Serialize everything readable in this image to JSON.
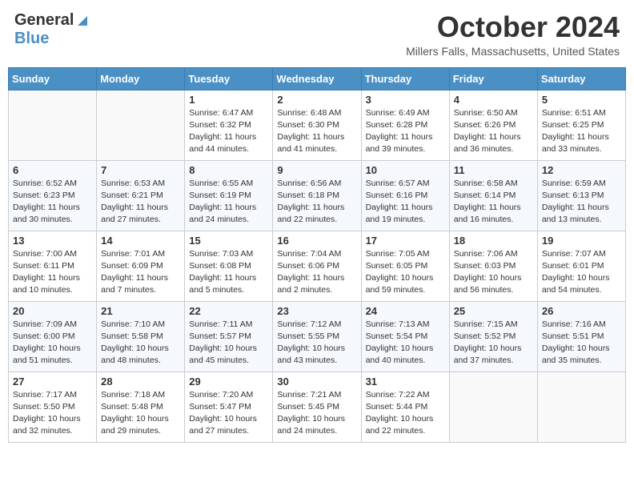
{
  "header": {
    "logo_general": "General",
    "logo_blue": "Blue",
    "month_title": "October 2024",
    "location": "Millers Falls, Massachusetts, United States"
  },
  "days_of_week": [
    "Sunday",
    "Monday",
    "Tuesday",
    "Wednesday",
    "Thursday",
    "Friday",
    "Saturday"
  ],
  "weeks": [
    [
      {
        "day": "",
        "info": ""
      },
      {
        "day": "",
        "info": ""
      },
      {
        "day": "1",
        "info": "Sunrise: 6:47 AM\nSunset: 6:32 PM\nDaylight: 11 hours and 44 minutes."
      },
      {
        "day": "2",
        "info": "Sunrise: 6:48 AM\nSunset: 6:30 PM\nDaylight: 11 hours and 41 minutes."
      },
      {
        "day": "3",
        "info": "Sunrise: 6:49 AM\nSunset: 6:28 PM\nDaylight: 11 hours and 39 minutes."
      },
      {
        "day": "4",
        "info": "Sunrise: 6:50 AM\nSunset: 6:26 PM\nDaylight: 11 hours and 36 minutes."
      },
      {
        "day": "5",
        "info": "Sunrise: 6:51 AM\nSunset: 6:25 PM\nDaylight: 11 hours and 33 minutes."
      }
    ],
    [
      {
        "day": "6",
        "info": "Sunrise: 6:52 AM\nSunset: 6:23 PM\nDaylight: 11 hours and 30 minutes."
      },
      {
        "day": "7",
        "info": "Sunrise: 6:53 AM\nSunset: 6:21 PM\nDaylight: 11 hours and 27 minutes."
      },
      {
        "day": "8",
        "info": "Sunrise: 6:55 AM\nSunset: 6:19 PM\nDaylight: 11 hours and 24 minutes."
      },
      {
        "day": "9",
        "info": "Sunrise: 6:56 AM\nSunset: 6:18 PM\nDaylight: 11 hours and 22 minutes."
      },
      {
        "day": "10",
        "info": "Sunrise: 6:57 AM\nSunset: 6:16 PM\nDaylight: 11 hours and 19 minutes."
      },
      {
        "day": "11",
        "info": "Sunrise: 6:58 AM\nSunset: 6:14 PM\nDaylight: 11 hours and 16 minutes."
      },
      {
        "day": "12",
        "info": "Sunrise: 6:59 AM\nSunset: 6:13 PM\nDaylight: 11 hours and 13 minutes."
      }
    ],
    [
      {
        "day": "13",
        "info": "Sunrise: 7:00 AM\nSunset: 6:11 PM\nDaylight: 11 hours and 10 minutes."
      },
      {
        "day": "14",
        "info": "Sunrise: 7:01 AM\nSunset: 6:09 PM\nDaylight: 11 hours and 7 minutes."
      },
      {
        "day": "15",
        "info": "Sunrise: 7:03 AM\nSunset: 6:08 PM\nDaylight: 11 hours and 5 minutes."
      },
      {
        "day": "16",
        "info": "Sunrise: 7:04 AM\nSunset: 6:06 PM\nDaylight: 11 hours and 2 minutes."
      },
      {
        "day": "17",
        "info": "Sunrise: 7:05 AM\nSunset: 6:05 PM\nDaylight: 10 hours and 59 minutes."
      },
      {
        "day": "18",
        "info": "Sunrise: 7:06 AM\nSunset: 6:03 PM\nDaylight: 10 hours and 56 minutes."
      },
      {
        "day": "19",
        "info": "Sunrise: 7:07 AM\nSunset: 6:01 PM\nDaylight: 10 hours and 54 minutes."
      }
    ],
    [
      {
        "day": "20",
        "info": "Sunrise: 7:09 AM\nSunset: 6:00 PM\nDaylight: 10 hours and 51 minutes."
      },
      {
        "day": "21",
        "info": "Sunrise: 7:10 AM\nSunset: 5:58 PM\nDaylight: 10 hours and 48 minutes."
      },
      {
        "day": "22",
        "info": "Sunrise: 7:11 AM\nSunset: 5:57 PM\nDaylight: 10 hours and 45 minutes."
      },
      {
        "day": "23",
        "info": "Sunrise: 7:12 AM\nSunset: 5:55 PM\nDaylight: 10 hours and 43 minutes."
      },
      {
        "day": "24",
        "info": "Sunrise: 7:13 AM\nSunset: 5:54 PM\nDaylight: 10 hours and 40 minutes."
      },
      {
        "day": "25",
        "info": "Sunrise: 7:15 AM\nSunset: 5:52 PM\nDaylight: 10 hours and 37 minutes."
      },
      {
        "day": "26",
        "info": "Sunrise: 7:16 AM\nSunset: 5:51 PM\nDaylight: 10 hours and 35 minutes."
      }
    ],
    [
      {
        "day": "27",
        "info": "Sunrise: 7:17 AM\nSunset: 5:50 PM\nDaylight: 10 hours and 32 minutes."
      },
      {
        "day": "28",
        "info": "Sunrise: 7:18 AM\nSunset: 5:48 PM\nDaylight: 10 hours and 29 minutes."
      },
      {
        "day": "29",
        "info": "Sunrise: 7:20 AM\nSunset: 5:47 PM\nDaylight: 10 hours and 27 minutes."
      },
      {
        "day": "30",
        "info": "Sunrise: 7:21 AM\nSunset: 5:45 PM\nDaylight: 10 hours and 24 minutes."
      },
      {
        "day": "31",
        "info": "Sunrise: 7:22 AM\nSunset: 5:44 PM\nDaylight: 10 hours and 22 minutes."
      },
      {
        "day": "",
        "info": ""
      },
      {
        "day": "",
        "info": ""
      }
    ]
  ]
}
